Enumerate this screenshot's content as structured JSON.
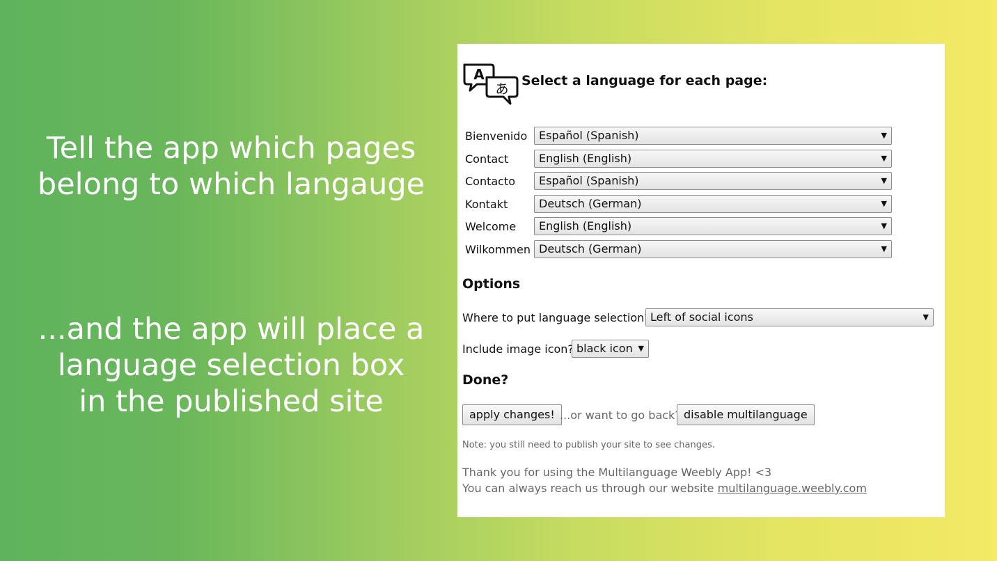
{
  "captions": {
    "first": [
      "Tell the app which pages",
      "belong to which langauge"
    ],
    "second": [
      "...and the app will place a",
      "language selection box",
      "in the published site"
    ]
  },
  "panel": {
    "title": "Select a language for each page:",
    "header_icon": "language-translate-icon",
    "pages": [
      {
        "label": "Bienvenido",
        "language": "Español (Spanish)"
      },
      {
        "label": "Contact",
        "language": "English (English)"
      },
      {
        "label": "Contacto",
        "language": "Español (Spanish)"
      },
      {
        "label": "Kontakt",
        "language": "Deutsch (German)"
      },
      {
        "label": "Welcome",
        "language": "English (English)"
      },
      {
        "label": "Wilkommen",
        "language": "Deutsch (German)"
      }
    ],
    "options": {
      "heading": "Options",
      "position_label": "Where to put language selection?",
      "position_value": "Left of social icons",
      "icon_label": "Include image icon?",
      "icon_value": "black icon"
    },
    "done": {
      "heading": "Done?",
      "apply_label": "apply changes!",
      "back_text": "...or want to go back?",
      "disable_label": "disable multilanguage",
      "note": "Note: you still need to publish your site to see changes."
    },
    "footer": {
      "thanks": "Thank you for using the Multilanguage Weebly App! <3",
      "reach_text": "You can always reach us through our website",
      "link": "multilanguage.weebly.com"
    }
  },
  "colors": {
    "panel_bg": "#ffffff",
    "gradient_start": "#5fb35c",
    "gradient_end": "#f4ea64"
  }
}
